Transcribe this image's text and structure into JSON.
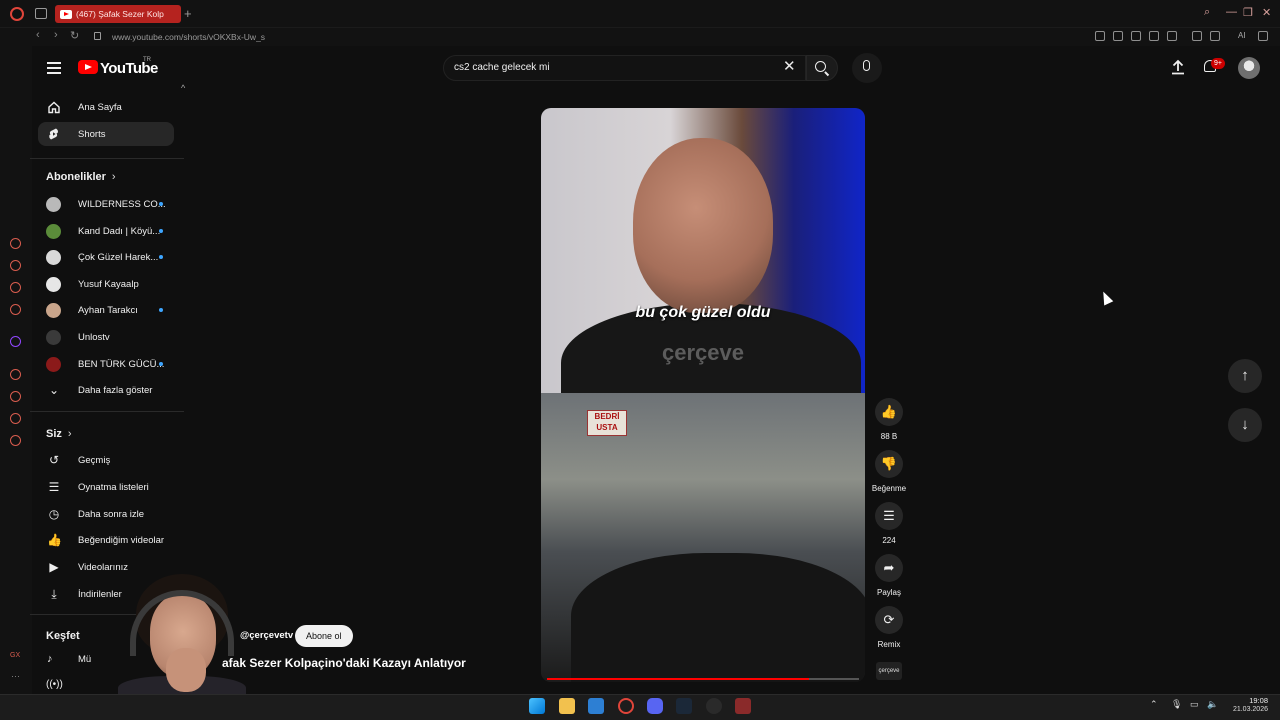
{
  "browser": {
    "tab_title": "(467) Şafak Sezer Kolp",
    "url": "www.youtube.com/shorts/vOKXBx-Uw_s",
    "ai_label": "AI"
  },
  "header": {
    "logo_text": "YouTube",
    "region": "TR",
    "search_value": "cs2 cache gelecek mi",
    "notif_count": "9+"
  },
  "sidebar": {
    "main": [
      {
        "label": "Ana Sayfa",
        "icon": "home-icon"
      },
      {
        "label": "Shorts",
        "icon": "shorts-icon"
      }
    ],
    "subs_title": "Abonelikler",
    "subscriptions": [
      {
        "label": "WILDERNESS CO...",
        "live": true,
        "color": "#b9b9b9"
      },
      {
        "label": "Kand Dadı | Köyü...",
        "live": true,
        "color": "#5b8c3a"
      },
      {
        "label": "Çok Güzel Harek...",
        "live": true,
        "color": "#d9d9d9"
      },
      {
        "label": "Yusuf Kayaalp",
        "live": false,
        "color": "#e6e6e6"
      },
      {
        "label": "Ayhan Tarakcı",
        "live": true,
        "color": "#c9a58b"
      },
      {
        "label": "Unlostv",
        "live": false,
        "color": "#3a3a3a"
      },
      {
        "label": "BEN TÜRK GÜCÜ...",
        "live": true,
        "color": "#8b1a1a"
      }
    ],
    "show_more": "Daha fazla göster",
    "you_title": "Siz",
    "you_items": [
      {
        "label": "Geçmiş",
        "icon": "history-icon"
      },
      {
        "label": "Oynatma listeleri",
        "icon": "playlists-icon"
      },
      {
        "label": "Daha sonra izle",
        "icon": "watch-later-icon"
      },
      {
        "label": "Beğendiğim videolar",
        "icon": "liked-icon"
      },
      {
        "label": "Videolarınız",
        "icon": "your-videos-icon"
      },
      {
        "label": "İndirilenler",
        "icon": "downloads-icon"
      }
    ],
    "explore_title": "Keşfet",
    "explore_partial": "Mü"
  },
  "short": {
    "subtitle": "bu çok güzel oldu",
    "watermark": "çerçeve",
    "sign": "BEDRİ USTA",
    "progress": 0.84,
    "channel_handle": "@çerçevetv",
    "subscribe_label": "Abone ol",
    "title": "afak Sezer Kolpaçino'daki Kazayı Anlatıyor",
    "actions": [
      {
        "name": "like",
        "icon": "👍",
        "label": "88 B"
      },
      {
        "name": "dislike",
        "icon": "👎",
        "label": "Beğenme"
      },
      {
        "name": "comments",
        "icon": "☰",
        "label": "224"
      },
      {
        "name": "share",
        "icon": "➦",
        "label": "Paylaş"
      },
      {
        "name": "remix",
        "icon": "⟳",
        "label": "Remix"
      }
    ],
    "channel_thumb": "çerçeve"
  },
  "taskbar": {
    "time": "19:08",
    "date": "21.03.2026"
  }
}
